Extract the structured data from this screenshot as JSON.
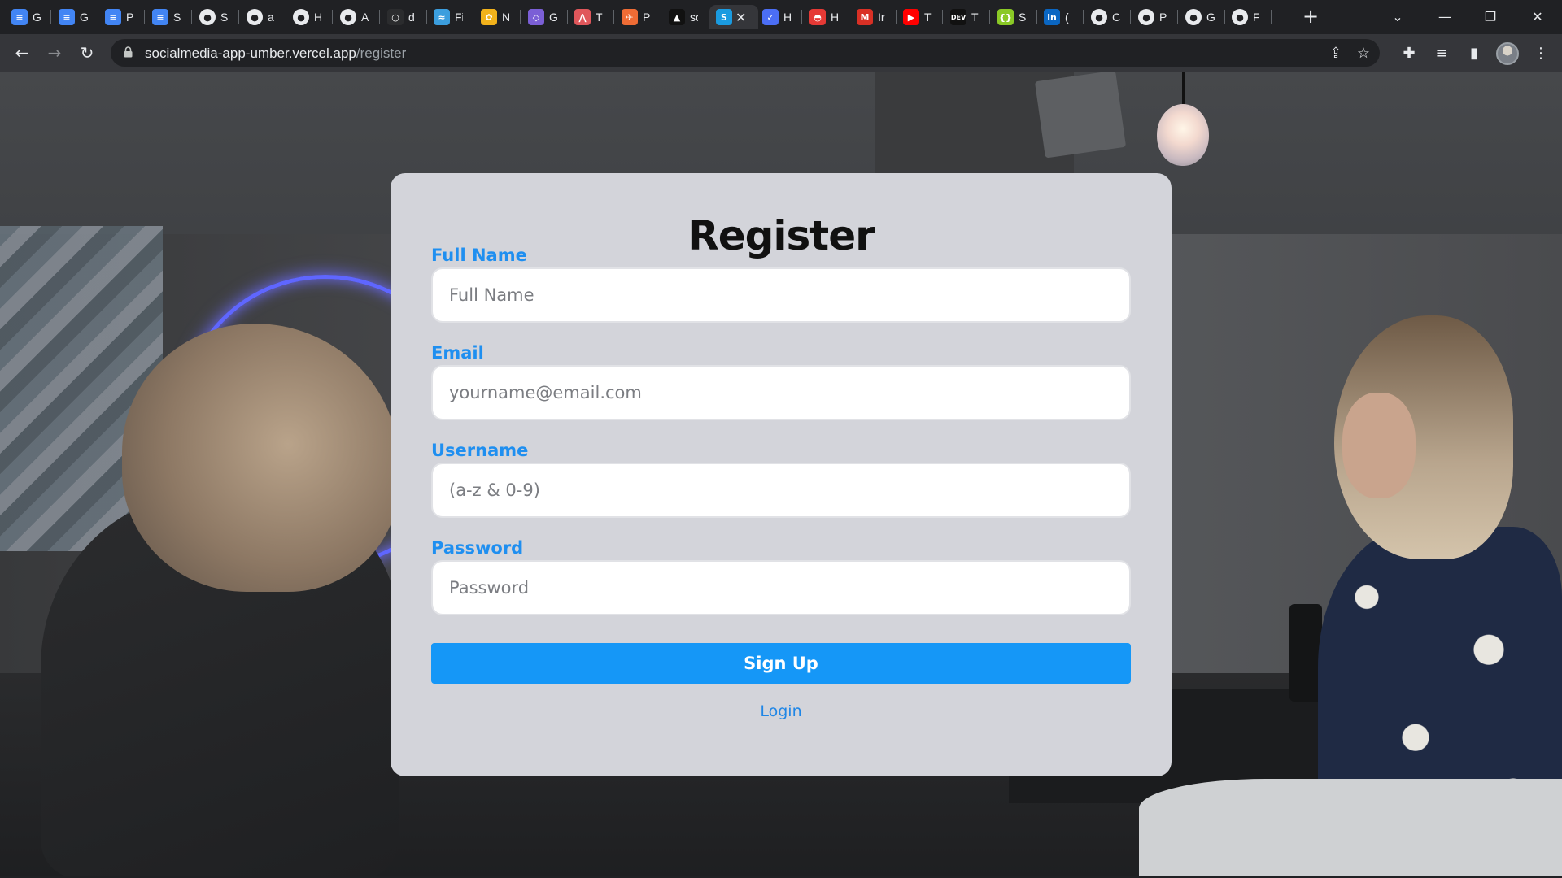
{
  "browser": {
    "tabs": [
      {
        "initial": "G",
        "icon": "google-docs-icon",
        "color": "#4285f4",
        "symbol": "≡"
      },
      {
        "initial": "G",
        "icon": "google-docs-icon",
        "color": "#4285f4",
        "symbol": "≡"
      },
      {
        "initial": "P",
        "icon": "google-docs-icon",
        "color": "#4285f4",
        "symbol": "≡"
      },
      {
        "initial": "S",
        "icon": "google-docs-icon",
        "color": "#4285f4",
        "symbol": "≡"
      },
      {
        "initial": "S",
        "icon": "github-icon",
        "color": "#e8eaed",
        "symbol": "●"
      },
      {
        "initial": "a",
        "icon": "github-icon",
        "color": "#e8eaed",
        "symbol": "●"
      },
      {
        "initial": "H",
        "icon": "github-icon",
        "color": "#e8eaed",
        "symbol": "●"
      },
      {
        "initial": "A",
        "icon": "github-icon",
        "color": "#e8eaed",
        "symbol": "●"
      },
      {
        "initial": "d",
        "icon": "dark-circle-icon",
        "color": "#2b2c2e",
        "symbol": "○"
      },
      {
        "initial": "Fi",
        "icon": "wave-icon",
        "color": "#3b9ede",
        "symbol": "≈"
      },
      {
        "initial": "N",
        "icon": "flower-icon",
        "color": "#f2b21b",
        "symbol": "✿"
      },
      {
        "initial": "G",
        "icon": "graphql-icon",
        "color": "#7b5fd6",
        "symbol": "◇"
      },
      {
        "initial": "T",
        "icon": "chart-icon",
        "color": "#e0575b",
        "symbol": "⋀"
      },
      {
        "initial": "P",
        "icon": "postman-icon",
        "color": "#ef6c35",
        "symbol": "✈"
      },
      {
        "initial": "sc",
        "icon": "triangle-icon",
        "color": "#111111",
        "symbol": "▲"
      },
      {
        "initial": "",
        "icon": "skype-icon",
        "color": "#1a9be0",
        "symbol": "S",
        "active": true
      },
      {
        "initial": "H",
        "icon": "check-icon",
        "color": "#4b6ef5",
        "symbol": "✓"
      },
      {
        "initial": "H",
        "icon": "pokeball-icon",
        "color": "#e53935",
        "symbol": "◓"
      },
      {
        "initial": "Ir",
        "icon": "gmail-icon",
        "color": "#d93025",
        "symbol": "M"
      },
      {
        "initial": "T",
        "icon": "youtube-icon",
        "color": "#ff0000",
        "symbol": "▶"
      },
      {
        "initial": "T",
        "icon": "dev-icon",
        "color": "#111111",
        "symbol": "DEV"
      },
      {
        "initial": "S",
        "icon": "bracket-icon",
        "color": "#8ac926",
        "symbol": "{}"
      },
      {
        "initial": "(",
        "icon": "linkedin-icon",
        "color": "#0a66c2",
        "symbol": "in"
      },
      {
        "initial": "C",
        "icon": "github-icon",
        "color": "#e8eaed",
        "symbol": "●"
      },
      {
        "initial": "P",
        "icon": "github-icon",
        "color": "#e8eaed",
        "symbol": "●"
      },
      {
        "initial": "G",
        "icon": "github-icon",
        "color": "#e8eaed",
        "symbol": "●"
      },
      {
        "initial": "F",
        "icon": "github-icon",
        "color": "#e8eaed",
        "symbol": "●"
      }
    ],
    "url_host": "socialmedia-app-umber.vercel.app",
    "url_path": "/register"
  },
  "form": {
    "title": "Register",
    "fields": [
      {
        "label": "Full Name",
        "placeholder": "Full Name",
        "value": ""
      },
      {
        "label": "Email",
        "placeholder": "yourname@email.com",
        "value": ""
      },
      {
        "label": "Username",
        "placeholder": "(a-z & 0-9)",
        "value": ""
      },
      {
        "label": "Password",
        "placeholder": "Password",
        "value": ""
      }
    ],
    "submit_label": "Sign Up",
    "login_label": "Login"
  },
  "colors": {
    "accent": "#1597f7",
    "label": "#1f8ff0",
    "card": "#d3d4da"
  }
}
